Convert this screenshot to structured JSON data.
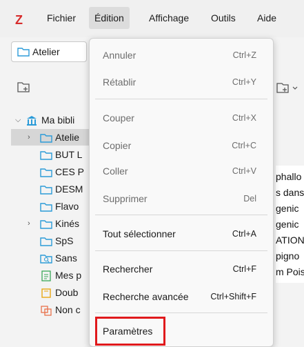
{
  "app": {
    "logo": "Z",
    "menus": [
      "Fichier",
      "Édition",
      "Affichage",
      "Outils",
      "Aide"
    ],
    "active_menu": "Édition"
  },
  "tab": {
    "label": "Atelier"
  },
  "tree": {
    "library": "Ma bibli",
    "items": [
      {
        "label": "Atelie",
        "selected": true,
        "has_chevron": true
      },
      {
        "label": "BUT L",
        "has_chevron": false
      },
      {
        "label": "CES P",
        "has_chevron": false
      },
      {
        "label": "DESM",
        "has_chevron": false
      },
      {
        "label": "Flavo",
        "has_chevron": false
      },
      {
        "label": "Kinés",
        "has_chevron": true
      },
      {
        "label": "SpS",
        "has_chevron": false
      },
      {
        "label": "Sans",
        "has_chevron": false,
        "icon": "search-folder-icon"
      },
      {
        "label": "Mes p",
        "has_chevron": false,
        "icon": "document-icon"
      },
      {
        "label": "Doub",
        "has_chevron": false,
        "icon": "duplicate-icon"
      },
      {
        "label": "Non c",
        "has_chevron": false,
        "icon": "unfiled-icon"
      }
    ]
  },
  "items_pane": [
    "phallo",
    "s dans",
    "genic",
    "genic",
    "ATION",
    "pigno",
    "m Pois"
  ],
  "edit_menu": {
    "items": [
      {
        "label": "Annuler",
        "shortcut": "Ctrl+Z",
        "enabled": false
      },
      {
        "label": "Rétablir",
        "shortcut": "Ctrl+Y",
        "enabled": false
      },
      {
        "label": "Couper",
        "shortcut": "Ctrl+X",
        "enabled": false
      },
      {
        "label": "Copier",
        "shortcut": "Ctrl+C",
        "enabled": false
      },
      {
        "label": "Coller",
        "shortcut": "Ctrl+V",
        "enabled": false
      },
      {
        "label": "Supprimer",
        "shortcut": "Del",
        "enabled": false
      },
      {
        "label": "Tout sélectionner",
        "shortcut": "Ctrl+A",
        "enabled": true
      },
      {
        "label": "Rechercher",
        "shortcut": "Ctrl+F",
        "enabled": true
      },
      {
        "label": "Recherche avancée",
        "shortcut": "Ctrl+Shift+F",
        "enabled": true
      },
      {
        "label": "Paramètres",
        "shortcut": "",
        "enabled": true,
        "highlighted": true
      }
    ]
  },
  "colors": {
    "logo": "#d72b2b",
    "highlight_border": "#e0191c",
    "folder": "#2b9bd8"
  }
}
